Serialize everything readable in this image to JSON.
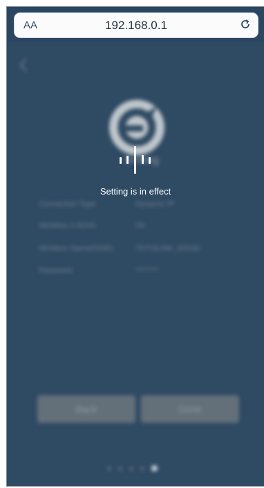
{
  "browser": {
    "text_size_label": "AA",
    "url": "192.168.0.1",
    "reload_icon": "reload-icon"
  },
  "page": {
    "background_color": "#2f4a63",
    "back_icon": "chevron-left-icon",
    "logo_icon": "brand-logo-icon",
    "blurred_title": "Setting",
    "info_rows": [
      {
        "label": "Connection Type",
        "value": "Dynamic IP"
      },
      {
        "label": "Wireless 2.4GHz",
        "value": "On"
      },
      {
        "label": "Wireless Name(SSID)",
        "value": "TOTOLINK_N3100"
      },
      {
        "label": "Password",
        "value": "********"
      }
    ],
    "buttons": {
      "back_label": "Back",
      "done_label": "Done"
    },
    "pagination": {
      "count": 5,
      "active_index": 4
    }
  },
  "overlay": {
    "loading_icon": "waveform-loading-icon",
    "status_text": "Setting is in effect"
  }
}
